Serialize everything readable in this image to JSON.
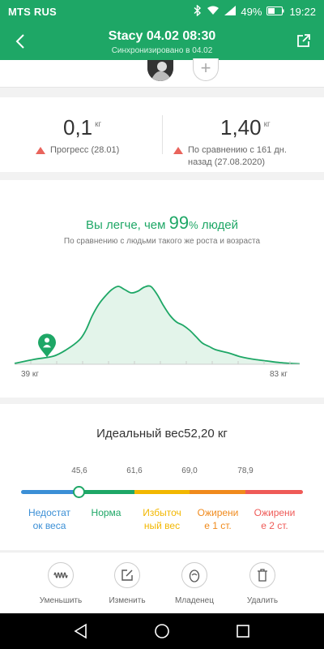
{
  "status_bar": {
    "carrier": "MTS RUS",
    "battery": "49%",
    "time": "19:22"
  },
  "header": {
    "title": "Stacy 04.02 08:30",
    "subtitle": "Синхронизировано в 04.02",
    "back_icon": "chevron-left-icon",
    "share_icon": "share-icon"
  },
  "avatar_strip": {
    "add_label": "+"
  },
  "stats": {
    "left": {
      "value": "0,1",
      "unit": "кг",
      "desc": "Прогресс (28.01)"
    },
    "right": {
      "value": "1,40",
      "unit": "кг",
      "desc_line1": "По сравнению с 161 дн.",
      "desc_line2": "назад (27.08.2020)"
    },
    "trend_color": "#e9645c"
  },
  "comparison": {
    "prefix": "Вы легче, чем ",
    "percent": "99",
    "percent_sign": "%",
    "suffix": " людей",
    "subtitle": "По сравнению с людьми такого же роста и возраста"
  },
  "chart_data": {
    "type": "area",
    "x_min_label": "39 кг",
    "x_max_label": "83 кг",
    "xlim": [
      39,
      83
    ],
    "x": [
      39,
      42,
      45,
      47,
      49,
      50,
      51,
      52,
      53,
      54,
      55,
      56,
      57,
      58,
      59,
      60,
      61,
      62,
      63,
      64,
      65,
      66,
      67,
      68,
      69,
      70,
      72,
      74,
      76,
      78,
      80,
      83
    ],
    "y": [
      0.01,
      0.06,
      0.1,
      0.18,
      0.3,
      0.42,
      0.6,
      0.74,
      0.84,
      0.92,
      0.96,
      0.92,
      0.88,
      0.9,
      0.95,
      0.96,
      0.86,
      0.72,
      0.6,
      0.52,
      0.48,
      0.42,
      0.34,
      0.26,
      0.22,
      0.18,
      0.14,
      0.09,
      0.06,
      0.04,
      0.02,
      0.005
    ],
    "marker_x": 44,
    "colors": {
      "line": "#1ea766",
      "fill": "#e3f4ea",
      "marker": "#1ea766"
    }
  },
  "ideal_weight": {
    "label": "Идеальный вес",
    "value": "52,20",
    "unit": "кг",
    "ticks": [
      "45,6",
      "61,6",
      "69,0",
      "78,9"
    ],
    "categories": [
      {
        "line1": "Недостат",
        "line2": "ок веса",
        "color": "#3b8fd6"
      },
      {
        "line1": "Норма",
        "line2": "",
        "color": "#1ea766"
      },
      {
        "line1": "Избыточ",
        "line2": "ный вес",
        "color": "#f2b700"
      },
      {
        "line1": "Ожирени",
        "line2": "е 1 ст.",
        "color": "#f08a1c"
      },
      {
        "line1": "Ожирени",
        "line2": "е 2 ст.",
        "color": "#ef5a57"
      }
    ]
  },
  "actions": {
    "reduce": "Уменьшить",
    "edit": "Изменить",
    "baby": "Младенец",
    "delete": "Удалить"
  }
}
